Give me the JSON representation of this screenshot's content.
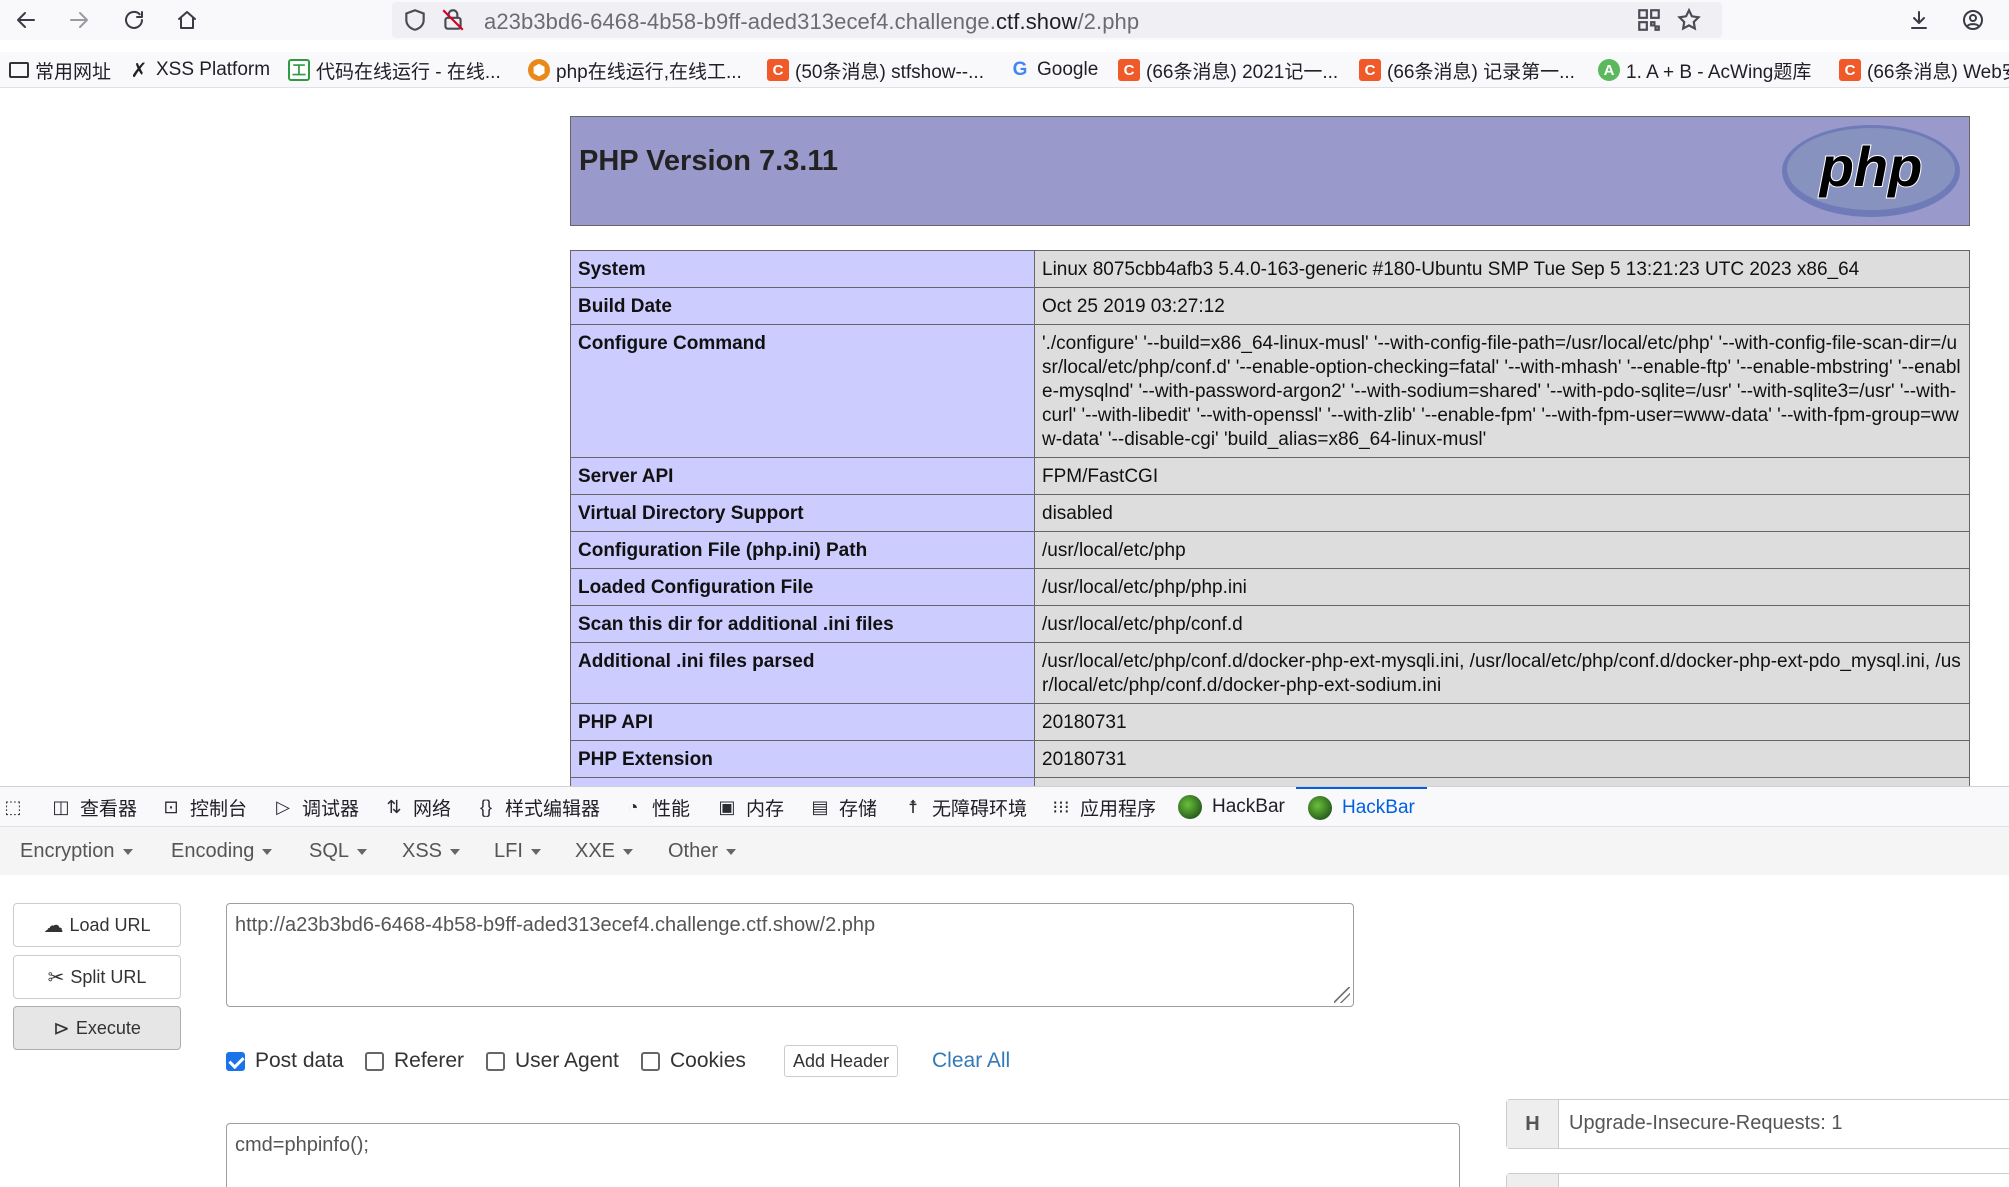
{
  "browser": {
    "url_prefix": "a23b3bd6-6468-4b58-b9ff-aded313ecef4.challenge.",
    "url_domain": "ctf.show",
    "url_suffix": "/2.php",
    "bookmarks": [
      {
        "label": "常用网址",
        "icon": "folder-icon"
      },
      {
        "label": "XSS Platform",
        "icon": "x-icon"
      },
      {
        "label": "代码在线运行 - 在线...",
        "icon": "code-icon"
      },
      {
        "label": "php在线运行,在线工...",
        "icon": "hex-icon"
      },
      {
        "label": "(50条消息) stfshow--...",
        "icon": "csdn-icon"
      },
      {
        "label": "Google",
        "icon": "google-icon"
      },
      {
        "label": "(66条消息) 2021记一...",
        "icon": "csdn-icon"
      },
      {
        "label": "(66条消息) 记录第一...",
        "icon": "csdn-icon"
      },
      {
        "label": "1. A + B - AcWing题库",
        "icon": "acwing-icon"
      },
      {
        "label": "(66条消息) Web安",
        "icon": "csdn-icon"
      }
    ]
  },
  "phpinfo": {
    "title": "PHP Version 7.3.11",
    "logo_text": "php",
    "rows": [
      {
        "key": "System",
        "value": "Linux 8075cbb4afb3 5.4.0-163-generic #180-Ubuntu SMP Tue Sep 5 13:21:23 UTC 2023 x86_64"
      },
      {
        "key": "Build Date",
        "value": "Oct 25 2019 03:27:12"
      },
      {
        "key": "Configure Command",
        "value": "'./configure' '--build=x86_64-linux-musl' '--with-config-file-path=/usr/local/etc/php' '--with-config-file-scan-dir=/usr/local/etc/php/conf.d' '--enable-option-checking=fatal' '--with-mhash' '--enable-ftp' '--enable-mbstring' '--enable-mysqlnd' '--with-password-argon2' '--with-sodium=shared' '--with-pdo-sqlite=/usr' '--with-sqlite3=/usr' '--with-curl' '--with-libedit' '--with-openssl' '--with-zlib' '--enable-fpm' '--with-fpm-user=www-data' '--with-fpm-group=www-data' '--disable-cgi' 'build_alias=x86_64-linux-musl'"
      },
      {
        "key": "Server API",
        "value": "FPM/FastCGI"
      },
      {
        "key": "Virtual Directory Support",
        "value": "disabled"
      },
      {
        "key": "Configuration File (php.ini) Path",
        "value": "/usr/local/etc/php"
      },
      {
        "key": "Loaded Configuration File",
        "value": "/usr/local/etc/php/php.ini"
      },
      {
        "key": "Scan this dir for additional .ini files",
        "value": "/usr/local/etc/php/conf.d"
      },
      {
        "key": "Additional .ini files parsed",
        "value": "/usr/local/etc/php/conf.d/docker-php-ext-mysqli.ini, /usr/local/etc/php/conf.d/docker-php-ext-pdo_mysql.ini, /usr/local/etc/php/conf.d/docker-php-ext-sodium.ini"
      },
      {
        "key": "PHP API",
        "value": "20180731"
      },
      {
        "key": "PHP Extension",
        "value": "20180731"
      },
      {
        "key": "",
        "value": ""
      }
    ]
  },
  "devtools": {
    "tabs": [
      {
        "label": "查看器",
        "icon": "inspector-icon"
      },
      {
        "label": "控制台",
        "icon": "console-icon"
      },
      {
        "label": "调试器",
        "icon": "debugger-icon"
      },
      {
        "label": "网络",
        "icon": "network-icon"
      },
      {
        "label": "样式编辑器",
        "icon": "style-editor-icon"
      },
      {
        "label": "性能",
        "icon": "performance-icon"
      },
      {
        "label": "内存",
        "icon": "memory-icon"
      },
      {
        "label": "存储",
        "icon": "storage-icon"
      },
      {
        "label": "无障碍环境",
        "icon": "accessibility-icon"
      },
      {
        "label": "应用程序",
        "icon": "application-icon"
      },
      {
        "label": "HackBar",
        "icon": "hackbar-icon"
      },
      {
        "label": "HackBar",
        "icon": "hackbar-icon"
      }
    ],
    "active_tab_index": 11
  },
  "hackbar": {
    "menu": [
      "Encryption",
      "Encoding",
      "SQL",
      "XSS",
      "LFI",
      "XXE",
      "Other"
    ],
    "load_url": "Load URL",
    "split_url": "Split URL",
    "execute": "Execute",
    "url_value": "http://a23b3bd6-6468-4b58-b9ff-aded313ecef4.challenge.ctf.show/2.php",
    "options": [
      {
        "label": "Post data",
        "checked": true
      },
      {
        "label": "Referer",
        "checked": false
      },
      {
        "label": "User Agent",
        "checked": false
      },
      {
        "label": "Cookies",
        "checked": false
      }
    ],
    "add_header": "Add Header",
    "clear_all": "Clear All",
    "post_body": "cmd=phpinfo();",
    "header_tag": "H",
    "header_value": "Upgrade-Insecure-Requests: 1"
  },
  "colors": {
    "php_header_bg": "#9999cc",
    "php_key_bg": "#ccccff",
    "php_value_bg": "#dddddd",
    "active_tab": "#0060df",
    "link": "#337ab7",
    "checkbox": "#1a73e8"
  }
}
